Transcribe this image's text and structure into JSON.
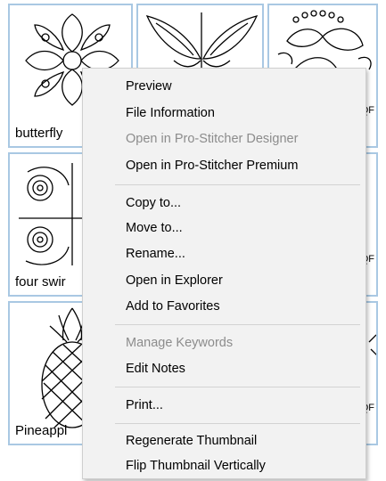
{
  "tiles": [
    {
      "name": "butterfly-tile",
      "caption": "butterfly"
    },
    {
      "name": "butterfly-leaf-tile",
      "caption": ""
    },
    {
      "name": "floral-tile",
      "caption_right": "IQF"
    },
    {
      "name": "four-swirl-tile",
      "caption": "four swir"
    },
    {
      "name": "middle-tile",
      "caption": ""
    },
    {
      "name": "right-tile-2",
      "caption_right": "IQF"
    },
    {
      "name": "pineapple-tile",
      "caption": "Pineappl"
    },
    {
      "name": "middle-tile-3",
      "caption": ""
    },
    {
      "name": "right-tile-3",
      "caption_right": "IQF"
    }
  ],
  "context_menu": {
    "items": [
      {
        "label": "Preview",
        "enabled": true
      },
      {
        "label": "File Information",
        "enabled": true
      },
      {
        "label": "Open in Pro-Stitcher Designer",
        "enabled": false
      },
      {
        "label": "Open in Pro-Stitcher Premium",
        "enabled": true
      },
      {
        "label": "Copy to...",
        "enabled": true
      },
      {
        "label": "Move to...",
        "enabled": true
      },
      {
        "label": "Rename...",
        "enabled": true
      },
      {
        "label": "Open in Explorer",
        "enabled": true
      },
      {
        "label": "Add to Favorites",
        "enabled": true
      },
      {
        "label": "Manage Keywords",
        "enabled": false
      },
      {
        "label": "Edit Notes",
        "enabled": true
      },
      {
        "label": "Print...",
        "enabled": true
      },
      {
        "label": "Regenerate Thumbnail",
        "enabled": true
      },
      {
        "label": "Flip Thumbnail Vertically",
        "enabled": true
      }
    ]
  },
  "colors": {
    "tile_border": "#a9c8e3",
    "menu_bg": "#f2f2f2",
    "disabled_text": "#8c8c8c"
  }
}
